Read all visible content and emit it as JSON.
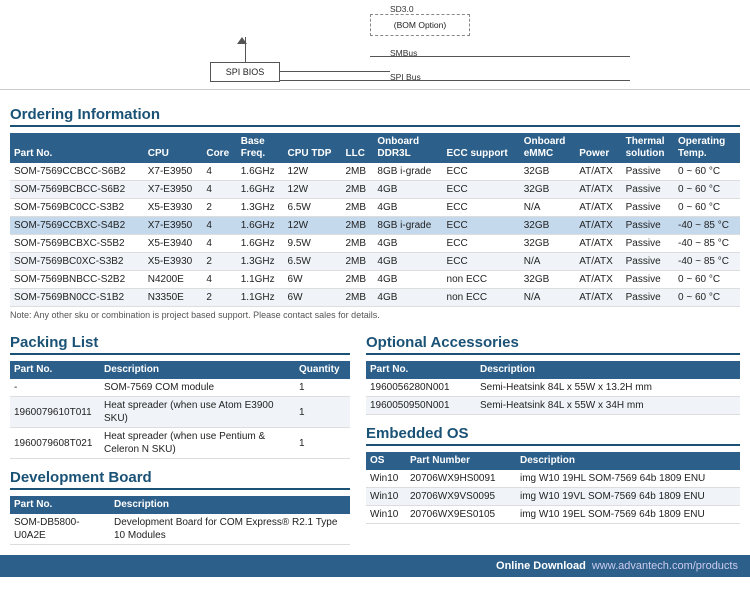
{
  "diagram": {
    "labels": {
      "sd30": "SD3.0",
      "bom_option": "(BOM Option)",
      "smbus": "SMBus",
      "spi_bios": "SPI BIOS",
      "spi_bus": "SPI Bus"
    }
  },
  "ordering": {
    "title": "Ordering Information",
    "columns": [
      "Part No.",
      "CPU",
      "Core",
      "Base\nFreq.",
      "CPU TDP",
      "LLC",
      "Onboard\nDDR3L",
      "ECC support",
      "Onboard\neMMC",
      "Power",
      "Thermal\nsolution",
      "Operating\nTemp."
    ],
    "rows": [
      {
        "part": "SOM-7569CCBCC-S6B2",
        "cpu": "X7-E3950",
        "core": "4",
        "freq": "1.6GHz",
        "tdp": "12W",
        "llc": "2MB",
        "ddr": "8GB i-grade",
        "ecc": "ECC",
        "emmc": "32GB",
        "power": "AT/ATX",
        "thermal": "Passive",
        "temp": "0 ~ 60 °C",
        "highlight": false
      },
      {
        "part": "SOM-7569BCBCC-S6B2",
        "cpu": "X7-E3950",
        "core": "4",
        "freq": "1.6GHz",
        "tdp": "12W",
        "llc": "2MB",
        "ddr": "4GB",
        "ecc": "ECC",
        "emmc": "32GB",
        "power": "AT/ATX",
        "thermal": "Passive",
        "temp": "0 ~ 60 °C",
        "highlight": false
      },
      {
        "part": "SOM-7569BC0CC-S3B2",
        "cpu": "X5-E3930",
        "core": "2",
        "freq": "1.3GHz",
        "tdp": "6.5W",
        "llc": "2MB",
        "ddr": "4GB",
        "ecc": "ECC",
        "emmc": "N/A",
        "power": "AT/ATX",
        "thermal": "Passive",
        "temp": "0 ~ 60 °C",
        "highlight": false
      },
      {
        "part": "SOM-7569CCBXC-S4B2",
        "cpu": "X7-E3950",
        "core": "4",
        "freq": "1.6GHz",
        "tdp": "12W",
        "llc": "2MB",
        "ddr": "8GB i-grade",
        "ecc": "ECC",
        "emmc": "32GB",
        "power": "AT/ATX",
        "thermal": "Passive",
        "temp": "-40 ~ 85 °C",
        "highlight": true
      },
      {
        "part": "SOM-7569BCBXC-S5B2",
        "cpu": "X5-E3940",
        "core": "4",
        "freq": "1.6GHz",
        "tdp": "9.5W",
        "llc": "2MB",
        "ddr": "4GB",
        "ecc": "ECC",
        "emmc": "32GB",
        "power": "AT/ATX",
        "thermal": "Passive",
        "temp": "-40 ~ 85 °C",
        "highlight": false
      },
      {
        "part": "SOM-7569BC0XC-S3B2",
        "cpu": "X5-E3930",
        "core": "2",
        "freq": "1.3GHz",
        "tdp": "6.5W",
        "llc": "2MB",
        "ddr": "4GB",
        "ecc": "ECC",
        "emmc": "N/A",
        "power": "AT/ATX",
        "thermal": "Passive",
        "temp": "-40 ~ 85 °C",
        "highlight": false
      },
      {
        "part": "SOM-7569BNBCC-S2B2",
        "cpu": "N4200E",
        "core": "4",
        "freq": "1.1GHz",
        "tdp": "6W",
        "llc": "2MB",
        "ddr": "4GB",
        "ecc": "non ECC",
        "emmc": "32GB",
        "power": "AT/ATX",
        "thermal": "Passive",
        "temp": "0 ~ 60 °C",
        "highlight": false
      },
      {
        "part": "SOM-7569BN0CC-S1B2",
        "cpu": "N3350E",
        "core": "2",
        "freq": "1.1GHz",
        "tdp": "6W",
        "llc": "2MB",
        "ddr": "4GB",
        "ecc": "non ECC",
        "emmc": "N/A",
        "power": "AT/ATX",
        "thermal": "Passive",
        "temp": "0 ~ 60 °C",
        "highlight": false
      }
    ],
    "note": "Note: Any other sku or combination is project based support. Please contact sales for details."
  },
  "packing": {
    "title": "Packing List",
    "columns": [
      "Part No.",
      "Description",
      "Quantity"
    ],
    "rows": [
      {
        "part": "-",
        "desc": "SOM-7569 COM module",
        "qty": "1"
      },
      {
        "part": "1960079610T011",
        "desc": "Heat spreader (when use Atom E3900 SKU)",
        "qty": "1"
      },
      {
        "part": "1960079608T021",
        "desc": "Heat spreader (when use Pentium & Celeron N SKU)",
        "qty": "1"
      }
    ]
  },
  "devboard": {
    "title": "Development Board",
    "columns": [
      "Part No.",
      "Description"
    ],
    "rows": [
      {
        "part": "SOM-DB5800-U0A2E",
        "desc": "Development Board for COM Express® R2.1 Type 10 Modules"
      }
    ]
  },
  "optional": {
    "title": "Optional Accessories",
    "columns": [
      "Part No.",
      "Description"
    ],
    "rows": [
      {
        "part": "1960056280N001",
        "desc": "Semi-Heatsink 84L x 55W x 13.2H mm"
      },
      {
        "part": "1960050950N001",
        "desc": "Semi-Heatsink 84L x 55W x 34H mm"
      }
    ]
  },
  "embedded_os": {
    "title": "Embedded OS",
    "columns": [
      "OS",
      "Part Number",
      "Description"
    ],
    "rows": [
      {
        "os": "Win10",
        "part_num": "20706WX9HS0091",
        "desc": "img W10 19HL SOM-7569 64b 1809 ENU"
      },
      {
        "os": "Win10",
        "part_num": "20706WX9VS0095",
        "desc": "img W10 19VL SOM-7569 64b 1809 ENU"
      },
      {
        "os": "Win10",
        "part_num": "20706WX9ES0105",
        "desc": "img W10 19EL SOM-7569 64b 1809 ENU"
      }
    ]
  },
  "footer": {
    "label": "Online Download",
    "url": "www.advantech.com/products"
  }
}
